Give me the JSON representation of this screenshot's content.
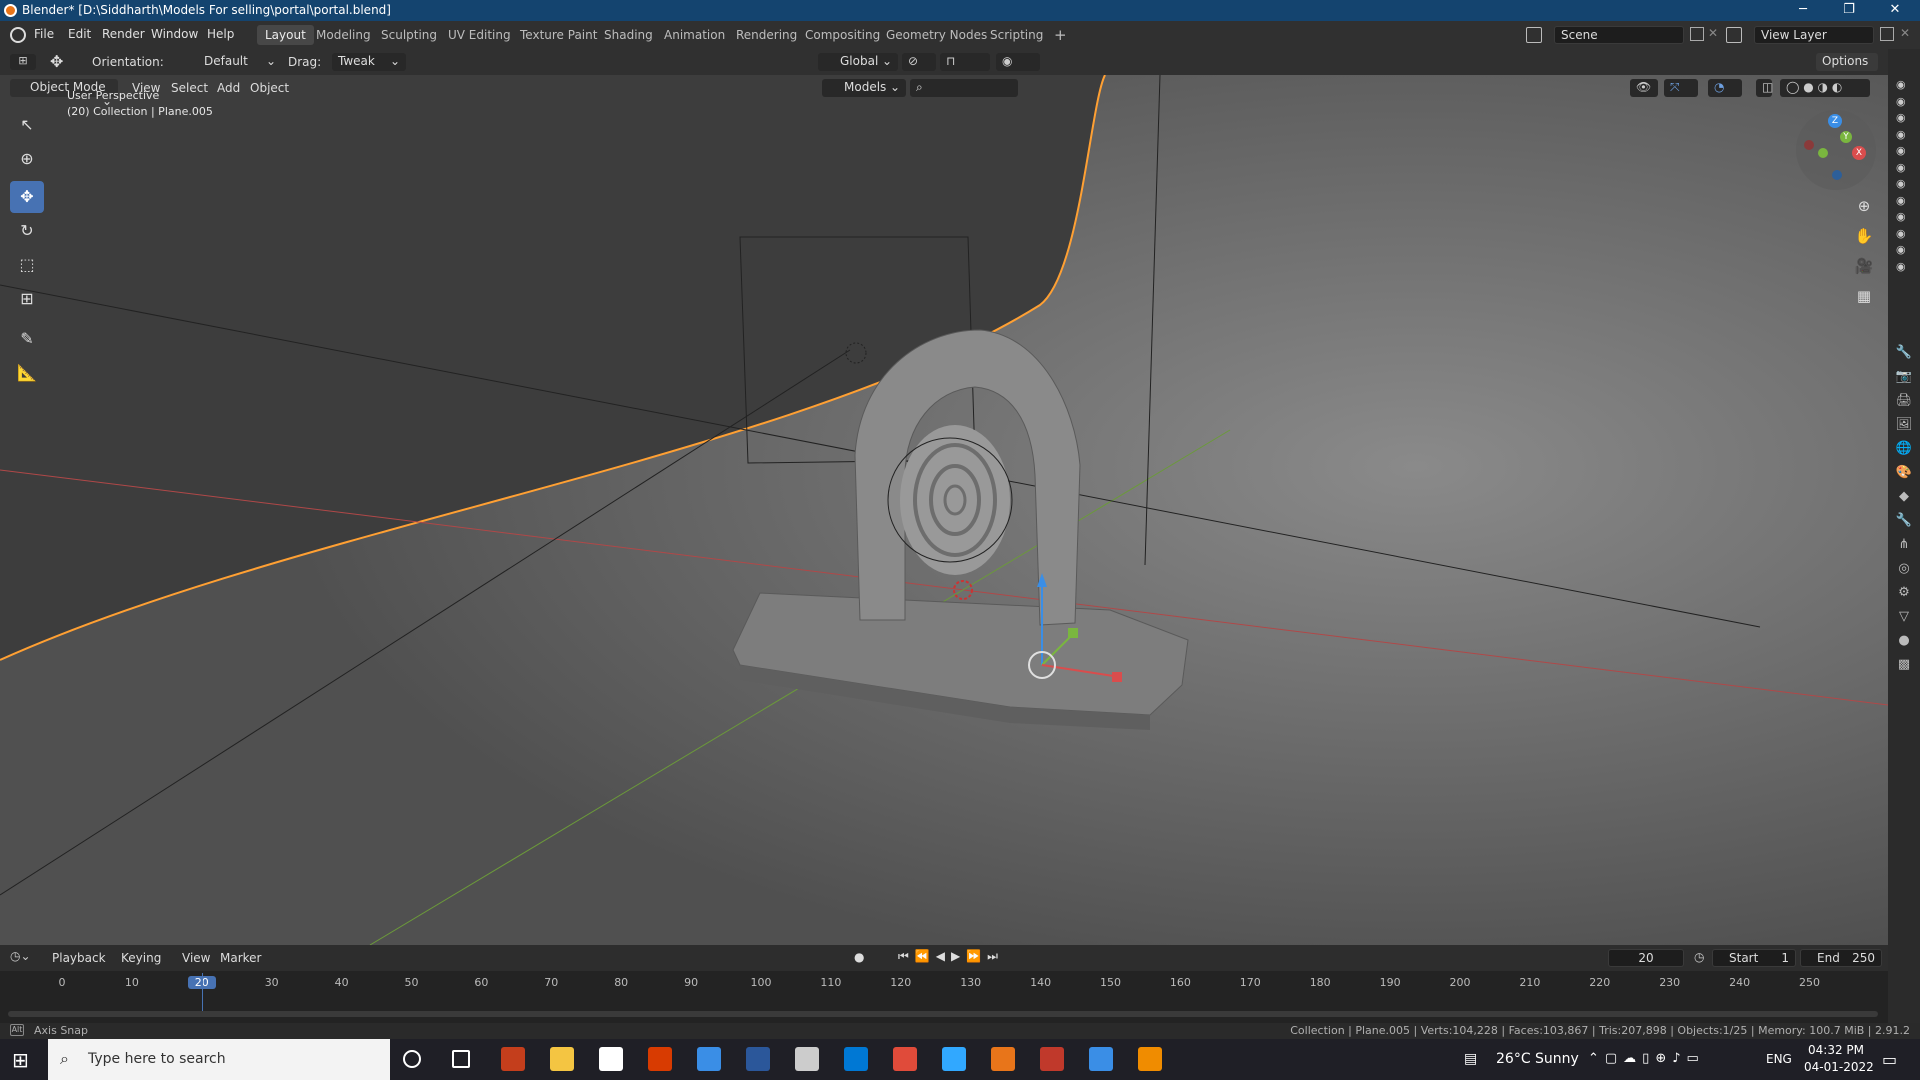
{
  "window": {
    "title": "Blender* [D:\\Siddharth\\Models For selling\\portal\\portal.blend]",
    "controls": [
      "─",
      "❐",
      "✕"
    ]
  },
  "menubar": {
    "menus": [
      "File",
      "Edit",
      "Render",
      "Window",
      "Help"
    ],
    "workspaces": [
      "Layout",
      "Modeling",
      "Sculpting",
      "UV Editing",
      "Texture Paint",
      "Shading",
      "Animation",
      "Rendering",
      "Compositing",
      "Geometry Nodes",
      "Scripting"
    ],
    "active_workspace": "Layout",
    "add_workspace": "+",
    "scene": "Scene",
    "view_layer": "View Layer"
  },
  "tool_header": {
    "orientation_label": "Orientation:",
    "orientation_value": "Default",
    "drag_label": "Drag:",
    "drag_value": "Tweak",
    "transform_orientation": "Global",
    "options": "Options"
  },
  "viewport_header": {
    "mode": "Object Mode",
    "menus": [
      "View",
      "Select",
      "Add",
      "Object"
    ],
    "asset_filter": "Models",
    "search_placeholder": ""
  },
  "viewport": {
    "view_name": "User Perspective",
    "collection_info": "(20) Collection | Plane.005",
    "gizmo_axes": {
      "z": "Z",
      "y": "Y",
      "x": "X"
    },
    "colors": {
      "bg": "#3c3c3c",
      "selection": "#ffa033",
      "x_axis": "#d94d4d",
      "y_axis": "#7ab63f",
      "z_axis": "#3a8ee6"
    }
  },
  "timeline": {
    "menus": [
      "Playback",
      "Keying",
      "View",
      "Marker"
    ],
    "current_frame": "20",
    "start_label": "Start",
    "start_value": "1",
    "end_label": "End",
    "end_value": "250",
    "ruler": [
      "0",
      "10",
      "20",
      "30",
      "40",
      "50",
      "60",
      "70",
      "80",
      "90",
      "100",
      "110",
      "120",
      "130",
      "140",
      "150",
      "160",
      "170",
      "180",
      "190",
      "200",
      "210",
      "220",
      "230",
      "240",
      "250"
    ]
  },
  "statusbar": {
    "left": "Axis Snap",
    "right": "Collection | Plane.005 | Verts:104,228 | Faces:103,867 | Tris:207,898 | Objects:1/25 | Memory: 100.7 MiB | 2.91.2"
  },
  "taskbar": {
    "search_placeholder": "Type here to search",
    "weather": "26°C  Sunny",
    "language": "ENG",
    "time": "04:32 PM",
    "date": "04-01-2022",
    "apps": [
      "cortana-icon",
      "task-view-icon",
      "powerpoint-icon",
      "file-explorer-icon",
      "store-icon",
      "office-icon",
      "app-icon",
      "word-icon",
      "app2-icon",
      "outlook-icon",
      "chrome-icon",
      "photoshop-icon",
      "blender-icon",
      "app3-icon",
      "vscode-icon",
      "vlc-icon"
    ]
  }
}
